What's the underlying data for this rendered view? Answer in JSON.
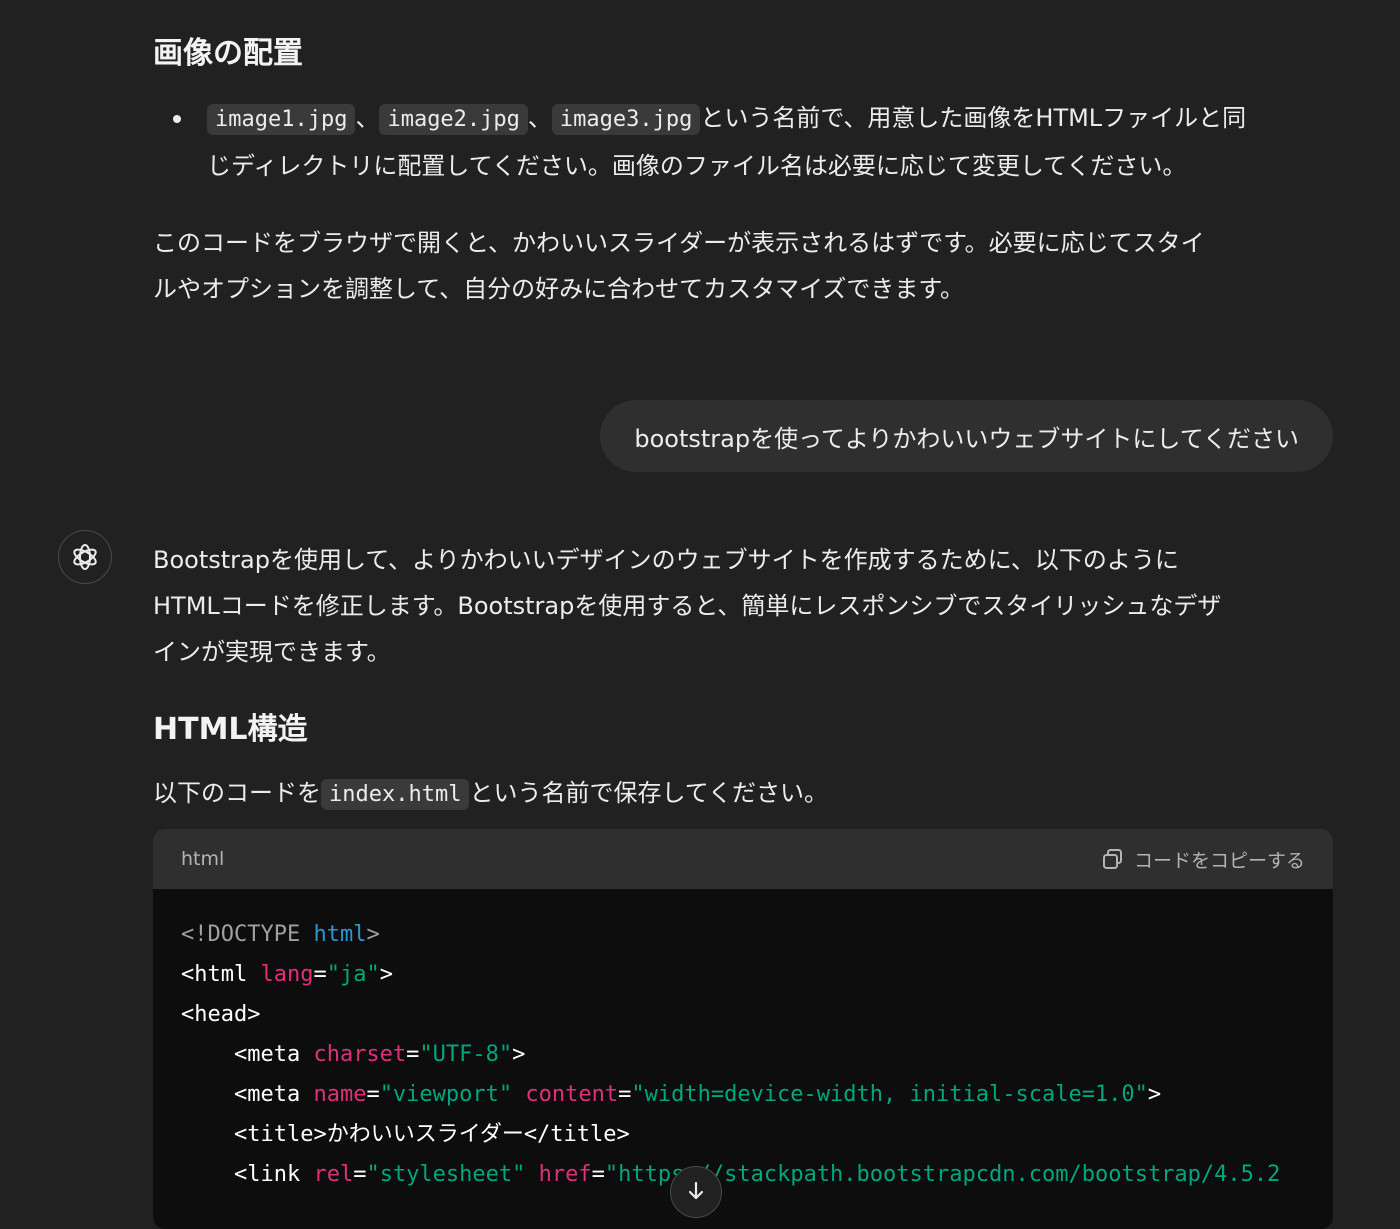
{
  "section1": {
    "heading": "画像の配置",
    "bullet": {
      "file1": "image1.jpg",
      "sep1": "、",
      "file2": "image2.jpg",
      "sep2": "、",
      "file3": "image3.jpg",
      "text_line1": "という名前で、用意した画像をHTMLファイルと同",
      "text_line2": "じディレクトリに配置してください。画像のファイル名は必要に応じて変更してください。"
    },
    "para_line1": "このコードをブラウザで開くと、かわいいスライダーが表示されるはずです。必要に応じてスタイ",
    "para_line2": "ルやオプションを調整して、自分の好みに合わせてカスタマイズできます。"
  },
  "user_message": "bootstrapを使ってよりかわいいウェブサイトにしてください",
  "assistant": {
    "intro_line1": "Bootstrapを使用して、よりかわいいデザインのウェブサイトを作成するために、以下のように",
    "intro_line2": "HTMLコードを修正します。Bootstrapを使用すると、簡単にレスポンシブでスタイリッシュなデザ",
    "intro_line3": "インが実現できます。",
    "heading": "HTML構造",
    "save_pre": "以下のコードを",
    "save_file": "index.html",
    "save_post": "という名前で保存してください。"
  },
  "codeblock": {
    "language": "html",
    "copy_label": "コードをコピーする",
    "lines": {
      "l1_a": "<!DOCTYPE ",
      "l1_b": "html",
      "l1_c": ">",
      "l2_a": "<html ",
      "l2_b": "lang",
      "l2_c": "=",
      "l2_d": "\"ja\"",
      "l2_e": ">",
      "l3_a": "<head>",
      "l4_a": "    <meta ",
      "l4_b": "charset",
      "l4_c": "=",
      "l4_d": "\"UTF-8\"",
      "l4_e": ">",
      "l5_a": "    <meta ",
      "l5_b": "name",
      "l5_c": "=",
      "l5_d": "\"viewport\"",
      "l5_e": " ",
      "l5_f": "content",
      "l5_g": "=",
      "l5_h": "\"width=device-width, initial-scale=1.0\"",
      "l5_i": ">",
      "l6_a": "    <title>かわいいスライダー</title>",
      "l7_a": "    <link ",
      "l7_b": "rel",
      "l7_c": "=",
      "l7_d": "\"stylesheet\"",
      "l7_e": " ",
      "l7_f": "href",
      "l7_g": "=",
      "l7_h": "\"https://stackpath.bootstrapcdn.com/bootstrap/4.5.2"
    }
  },
  "icons": {
    "assistant_avatar": "openai-logo-icon",
    "copy": "copy-icon",
    "scroll_down": "arrow-down-icon"
  }
}
